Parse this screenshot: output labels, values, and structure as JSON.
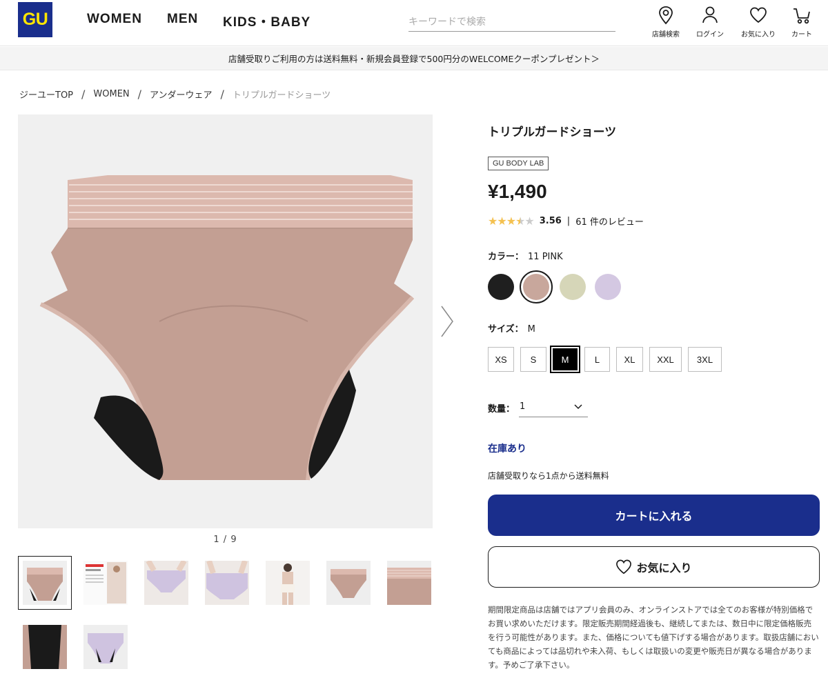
{
  "header": {
    "logo": "GU",
    "nav": [
      "WOMEN",
      "MEN",
      "KIDS・BABY"
    ],
    "search_placeholder": "キーワードで検索",
    "icons": [
      {
        "icon": "map-pin-icon",
        "label": "店舗検索"
      },
      {
        "icon": "user-icon",
        "label": "ログイン"
      },
      {
        "icon": "heart-icon",
        "label": "お気に入り"
      },
      {
        "icon": "cart-icon",
        "label": "カート"
      }
    ]
  },
  "promo": "店舗受取りご利用の方は送料無料・新規会員登録で500円分のWELCOMEクーポンプレゼント＞",
  "breadcrumb": [
    "ジーユーTOP",
    "WOMEN",
    "アンダーウェア",
    "トリプルガードショーツ"
  ],
  "gallery": {
    "counter": "1 / 9"
  },
  "product": {
    "title": "トリプルガードショーツ",
    "badge": "GU BODY LAB",
    "price": "¥1,490",
    "rating_score": "3.56",
    "rating_sep": "|",
    "review_count": "61 件のレビュー",
    "color_label": "カラー：",
    "color_value": "11 PINK",
    "colors": [
      "#1f1f1f",
      "#c8a79c",
      "#d6d6b8",
      "#d4c8e2"
    ],
    "size_label": "サイズ：",
    "size_value": "M",
    "sizes": [
      "XS",
      "S",
      "M",
      "L",
      "XL",
      "XXL",
      "3XL"
    ],
    "qty_label": "数量：",
    "qty_value": "1",
    "stock": "在庫あり",
    "ship_note": "店舗受取りなら1点から送料無料",
    "cart_button": "カートに入れる",
    "fav_button": "お気に入り",
    "disclaimer": "期間限定商品は店舗ではアプリ会員のみ、オンラインストアでは全てのお客様が特別価格でお買い求めいただけます。限定販売期間経過後も、継続してまたは、数日中に限定価格販売を行う可能性があります。また、価格についても値下げする場合があります。取扱店舗においても商品によっては品切れや未入荷、もしくは取扱いの変更や販売日が異なる場合があります。予めご了承下さい。"
  }
}
